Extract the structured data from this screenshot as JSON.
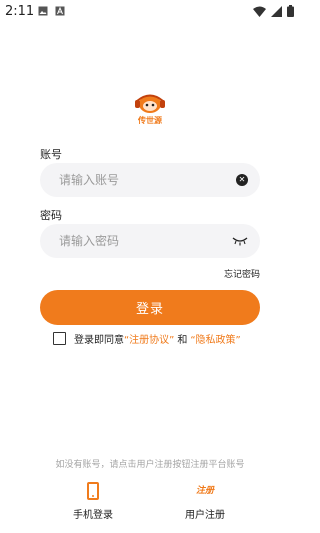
{
  "status_bar": {
    "time": "2:11"
  },
  "logo": {
    "text": "传世源",
    "icon": "monkey-headphones-logo-icon",
    "colors": {
      "primary": "#f07b1c",
      "secondary": "#c2410c"
    }
  },
  "form": {
    "account_label": "账号",
    "account_placeholder": "请输入账号",
    "password_label": "密码",
    "password_placeholder": "请输入密码",
    "forgot_password": "忘记密码",
    "login_button": "登录"
  },
  "agreement": {
    "prefix": "登录即同意",
    "terms": "“注册协议”",
    "and": "和",
    "privacy": "“隐私政策”",
    "checked": false
  },
  "hint": "如没有账号，请点击用户注册按钮注册平台账号",
  "bottom_actions": {
    "phone_login": "手机登录",
    "register_icon_text": "注册",
    "register": "用户注册"
  },
  "colors": {
    "accent": "#f07b1c",
    "input_bg": "#f4f4f6",
    "hint_text": "#a5a5a5"
  }
}
